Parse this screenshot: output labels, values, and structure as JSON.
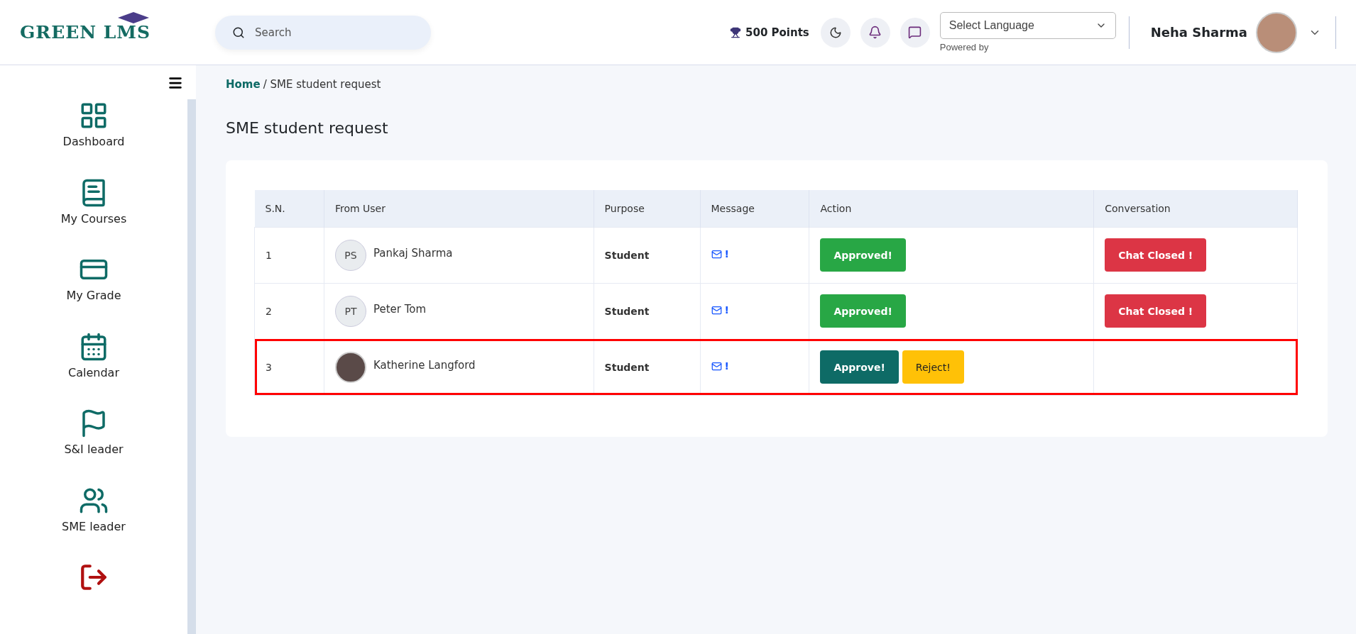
{
  "logo": {
    "text": "GREEN LMS"
  },
  "search": {
    "placeholder": "Search"
  },
  "points": "500 Points",
  "language": {
    "placeholder": "Select Language",
    "note": "Powered by"
  },
  "user": {
    "name": "Neha Sharma"
  },
  "sidebar": {
    "items": [
      {
        "label": "Dashboard",
        "kind": "dashboard"
      },
      {
        "label": "My Courses",
        "kind": "courses"
      },
      {
        "label": "My Grade",
        "kind": "grade"
      },
      {
        "label": "Calendar",
        "kind": "calendar"
      },
      {
        "label": "S&I leader",
        "kind": "si"
      },
      {
        "label": "SME leader",
        "kind": "sme"
      },
      {
        "kind": "logout"
      }
    ]
  },
  "breadcrumb": {
    "home": "Home",
    "current": "/ SME student request"
  },
  "page_title": "SME student request",
  "table": {
    "columns": [
      "S.N.",
      "From User",
      "Purpose",
      "Message",
      "Action",
      "Conversation"
    ],
    "rows": [
      {
        "sn": "1",
        "avatar": {
          "kind": "initials",
          "text": "PS"
        },
        "name": "Pankaj Sharma",
        "purpose": "Student",
        "message": "!",
        "highlighted": false,
        "kind": "approved",
        "actions": [
          "Approved!"
        ],
        "conversation": "Chat Closed !"
      },
      {
        "sn": "2",
        "avatar": {
          "kind": "initials",
          "text": "PT"
        },
        "name": "Peter Tom",
        "purpose": "Student",
        "message": "!",
        "highlighted": false,
        "kind": "approved",
        "actions": [
          "Approved!"
        ],
        "conversation": "Chat Closed !"
      },
      {
        "sn": "3",
        "avatar": {
          "kind": "photo"
        },
        "name": "Katherine Langford",
        "purpose": "Student",
        "message": "!",
        "highlighted": true,
        "kind": "pending",
        "actions": [
          "Approve!",
          "Reject!"
        ]
      }
    ]
  }
}
